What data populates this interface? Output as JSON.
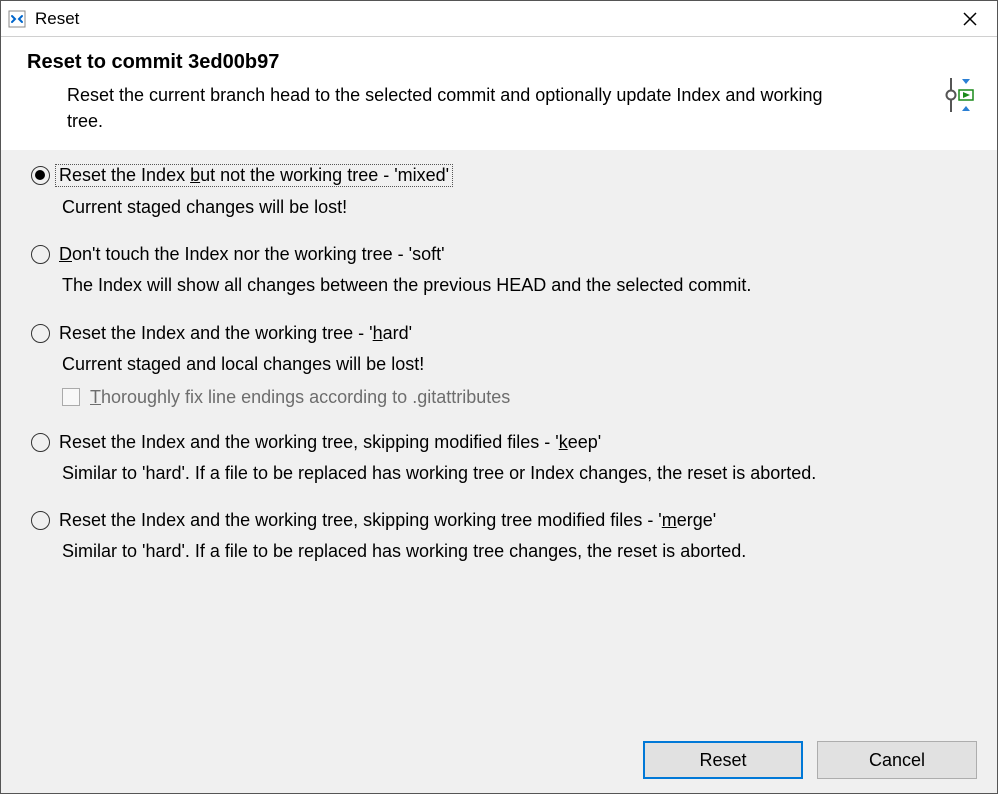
{
  "titlebar": {
    "title": "Reset"
  },
  "header": {
    "title": "Reset to commit 3ed00b97",
    "description": "Reset the current branch head to the selected commit and optionally update Index and working tree."
  },
  "options": {
    "mixed": {
      "label_pre": "Reset the Index ",
      "label_u": "b",
      "label_post": "ut not the working tree - 'mixed'",
      "description": "Current staged changes will be lost!"
    },
    "soft": {
      "label_u": "D",
      "label_post": "on't touch the Index nor the working tree - 'soft'",
      "description": "The Index will show all changes between the previous HEAD and the selected commit."
    },
    "hard": {
      "label_pre": "Reset the Index and the working tree - '",
      "label_u": "h",
      "label_post": "ard'",
      "description": "Current staged and local changes will be lost!",
      "checkbox_u": "T",
      "checkbox_post": "horoughly fix line endings according to .gitattributes"
    },
    "keep": {
      "label_pre": "Reset the Index and the working tree, skipping modified files - '",
      "label_u": "k",
      "label_post": "eep'",
      "description": "Similar to 'hard'. If a file to be replaced has working tree or Index changes, the reset is aborted."
    },
    "merge": {
      "label_pre": "Reset the Index and the working tree, skipping working tree modified files - '",
      "label_u": "m",
      "label_post": "erge'",
      "description": "Similar to 'hard'. If a file to be replaced has working tree changes, the reset is aborted."
    }
  },
  "buttons": {
    "reset": "Reset",
    "cancel": "Cancel"
  }
}
